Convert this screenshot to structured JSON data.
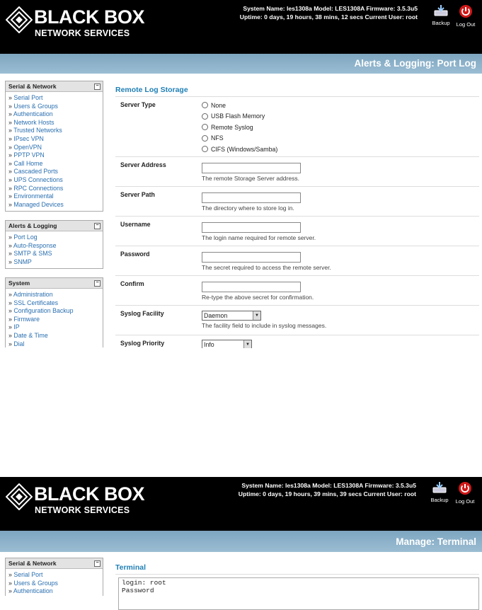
{
  "screen1": {
    "brand": {
      "name": "BLACK BOX",
      "sub": "NETWORK SERVICES"
    },
    "sysinfo": {
      "line1": "System Name: les1308a   Model: LES1308A   Firmware: 3.5.3u5",
      "line2": "Uptime: 0 days, 19 hours, 38 mins, 12 secs   Current User: root"
    },
    "header_buttons": {
      "backup": "Backup",
      "logout": "Log Out"
    },
    "page_title": "Alerts & Logging: Port Log",
    "sidebar": {
      "serial_network": {
        "title": "Serial & Network",
        "items": [
          "Serial Port",
          "Users & Groups",
          "Authentication",
          "Network Hosts",
          "Trusted Networks",
          "IPsec VPN",
          "OpenVPN",
          "PPTP VPN",
          "Call Home",
          "Cascaded Ports",
          "UPS Connections",
          "RPC Connections",
          "Environmental",
          "Managed Devices"
        ]
      },
      "alerts_logging": {
        "title": "Alerts & Logging",
        "items": [
          "Port Log",
          "Auto-Response",
          "SMTP & SMS",
          "SNMP"
        ]
      },
      "system": {
        "title": "System",
        "items": [
          "Administration",
          "SSL Certificates",
          "Configuration Backup",
          "Firmware",
          "IP",
          "Date & Time",
          "Dial"
        ]
      }
    },
    "section_title": "Remote Log Storage",
    "form": {
      "server_type": {
        "label": "Server Type",
        "options": [
          "None",
          "USB Flash Memory",
          "Remote Syslog",
          "NFS",
          "CIFS (Windows/Samba)"
        ]
      },
      "server_address": {
        "label": "Server Address",
        "help": "The remote Storage Server address.",
        "value": ""
      },
      "server_path": {
        "label": "Server Path",
        "help": "The directory where to store log in.",
        "value": ""
      },
      "username": {
        "label": "Username",
        "help": "The login name required for remote server.",
        "value": ""
      },
      "password": {
        "label": "Password",
        "help": "The secret required to access the remote server.",
        "value": ""
      },
      "confirm": {
        "label": "Confirm",
        "help": "Re-type the above secret for confirmation.",
        "value": ""
      },
      "syslog_facility": {
        "label": "Syslog Facility",
        "value": "Daemon",
        "help": "The facility field to include in syslog messages."
      },
      "syslog_priority": {
        "label": "Syslog Priority",
        "value": "Info"
      }
    }
  },
  "screen2": {
    "brand": {
      "name": "BLACK BOX",
      "sub": "NETWORK SERVICES"
    },
    "sysinfo": {
      "line1": "System Name: les1308a   Model: LES1308A   Firmware: 3.5.3u5",
      "line2": "Uptime: 0 days, 19 hours, 39 mins, 39 secs   Current User: root"
    },
    "header_buttons": {
      "backup": "Backup",
      "logout": "Log Out"
    },
    "page_title": "Manage: Terminal",
    "sidebar": {
      "title": "Serial & Network",
      "items": [
        "Serial Port",
        "Users & Groups",
        "Authentication"
      ]
    },
    "section_title": "Terminal",
    "terminal_text": "login: root\nPassword"
  }
}
